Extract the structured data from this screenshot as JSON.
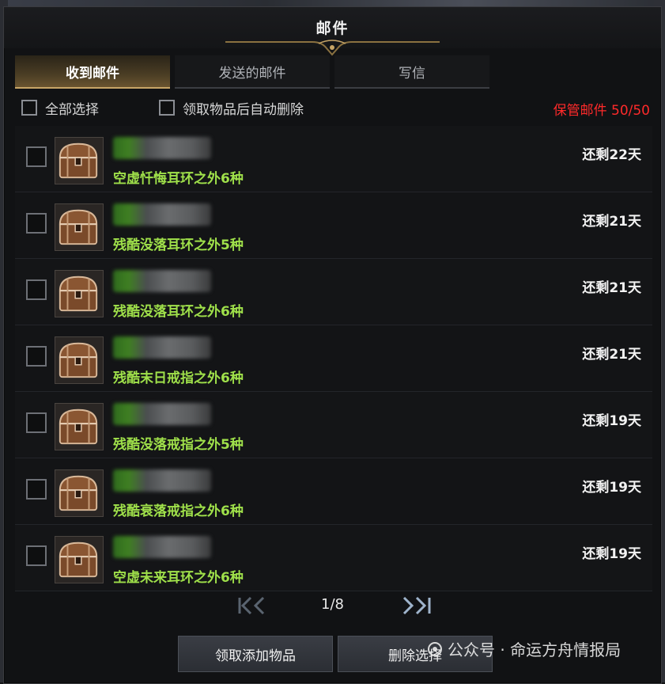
{
  "window": {
    "title": "邮件"
  },
  "tabs": [
    {
      "label": "收到邮件",
      "active": true
    },
    {
      "label": "发送的邮件",
      "active": false
    },
    {
      "label": "写信",
      "active": false
    }
  ],
  "options": {
    "select_all": "全部选择",
    "auto_delete": "领取物品后自动删除"
  },
  "storage": {
    "label": "保管邮件 50/50",
    "color": "#ff2a2a"
  },
  "mails": [
    {
      "subject": "空虚忏悔耳环之外6种",
      "remaining": "还剩22天"
    },
    {
      "subject": "残酷没落耳环之外5种",
      "remaining": "还剩21天"
    },
    {
      "subject": "残酷没落耳环之外6种",
      "remaining": "还剩21天"
    },
    {
      "subject": "残酷末日戒指之外6种",
      "remaining": "还剩21天"
    },
    {
      "subject": "残酷没落戒指之外5种",
      "remaining": "还剩19天"
    },
    {
      "subject": "残酷衰落戒指之外6种",
      "remaining": "还剩19天"
    },
    {
      "subject": "空虚未来耳环之外6种",
      "remaining": "还剩19天"
    }
  ],
  "pagination": {
    "page": "1/8"
  },
  "buttons": {
    "receive": "领取添加物品",
    "delete": "删除选择"
  },
  "watermark": {
    "text": "公众号 · 命运方舟情报局"
  },
  "colors": {
    "subject": "#9fe04a",
    "accent_gold": "#c7a567"
  }
}
